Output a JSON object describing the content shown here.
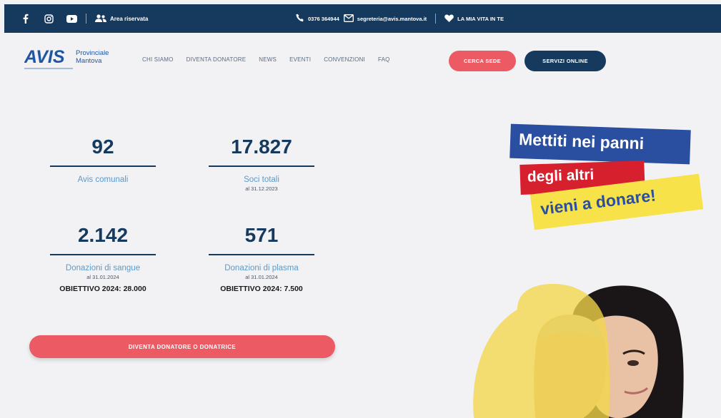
{
  "topbar": {
    "reserved_label": "Area riservata",
    "phone": "0376 364944",
    "email": "segreteria@avis.mantova.it",
    "life_label": "LA MIA VITA IN TE"
  },
  "logo": {
    "mark": "AVIS",
    "line1": "Provinciale",
    "line2": "Mantova"
  },
  "nav": {
    "items": [
      "CHI SIAMO",
      "DIVENTA DONATORE",
      "NEWS",
      "EVENTI",
      "CONVENZIONI",
      "FAQ"
    ],
    "cerca_sede": "CERCA SEDE",
    "servizi_online": "SERVIZI ONLINE"
  },
  "stats": [
    {
      "value": "92",
      "label": "Avis comunali",
      "date": "",
      "goal": ""
    },
    {
      "value": "17.827",
      "label": "Soci totali",
      "date": "al 31.12.2023",
      "goal": ""
    },
    {
      "value": "2.142",
      "label": "Donazioni di sangue",
      "date": "al 31.01.2024",
      "goal": "OBIETTIVO 2024: 28.000"
    },
    {
      "value": "571",
      "label": "Donazioni di plasma",
      "date": "al 31.01.2024",
      "goal": "OBIETTIVO 2024: 7.500"
    }
  ],
  "cta_label": "DIVENTA DONATORE O DONATRICE",
  "slogan": {
    "line1": "Mettiti nei panni",
    "line2": "degli altri",
    "line3": "vieni a donare!"
  },
  "colors": {
    "navy": "#163a5e",
    "red": "#ec5a63",
    "blue_label": "#5b9ac9",
    "slogan_blue": "#2b4fa0",
    "slogan_red": "#d7202e",
    "slogan_yellow": "#f7e24a"
  },
  "icons": [
    "facebook-icon",
    "instagram-icon",
    "youtube-icon",
    "users-icon",
    "phone-icon",
    "mail-icon",
    "heart-icon"
  ]
}
